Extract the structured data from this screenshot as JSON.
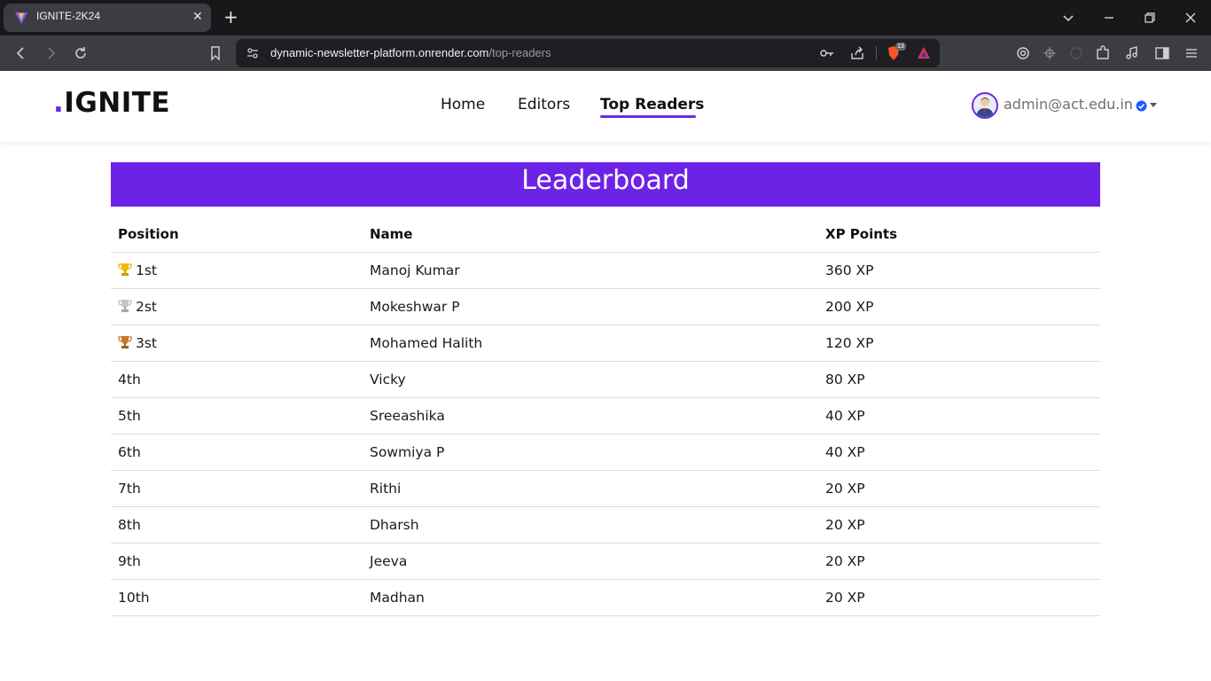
{
  "browser": {
    "tab_title": "IGNITE-2K24",
    "url_host": "dynamic-newsletter-platform.onrender.com",
    "url_path": "/top-readers",
    "shields_count": "13"
  },
  "header": {
    "logo_dot": ".",
    "logo_text": "IGNITE",
    "nav": [
      {
        "label": "Home"
      },
      {
        "label": "Editors"
      },
      {
        "label": "Top Readers",
        "active": true
      }
    ],
    "user_email": "admin@act.edu.in"
  },
  "leaderboard": {
    "title": "Leaderboard",
    "columns": [
      "Position",
      "Name",
      "XP Points"
    ],
    "rows": [
      {
        "position": "1st",
        "name": "Manoj Kumar",
        "xp": "360 XP",
        "trophy": "gold"
      },
      {
        "position": "2st",
        "name": "Mokeshwar P",
        "xp": "200 XP",
        "trophy": "silver"
      },
      {
        "position": "3st",
        "name": "Mohamed Halith",
        "xp": "120 XP",
        "trophy": "bronze"
      },
      {
        "position": "4th",
        "name": "Vicky",
        "xp": "80 XP"
      },
      {
        "position": "5th",
        "name": "Sreeashika",
        "xp": "40 XP"
      },
      {
        "position": "6th",
        "name": "Sowmiya P",
        "xp": "40 XP"
      },
      {
        "position": "7th",
        "name": "Rithi",
        "xp": "20 XP"
      },
      {
        "position": "8th",
        "name": "Dharsh",
        "xp": "20 XP"
      },
      {
        "position": "9th",
        "name": "Jeeva",
        "xp": "20 XP"
      },
      {
        "position": "10th",
        "name": "Madhan",
        "xp": "20 XP"
      }
    ]
  },
  "colors": {
    "accent": "#6d23e6",
    "gold": "#f2b705",
    "silver": "#bfbfbf",
    "bronze": "#c8782a"
  }
}
